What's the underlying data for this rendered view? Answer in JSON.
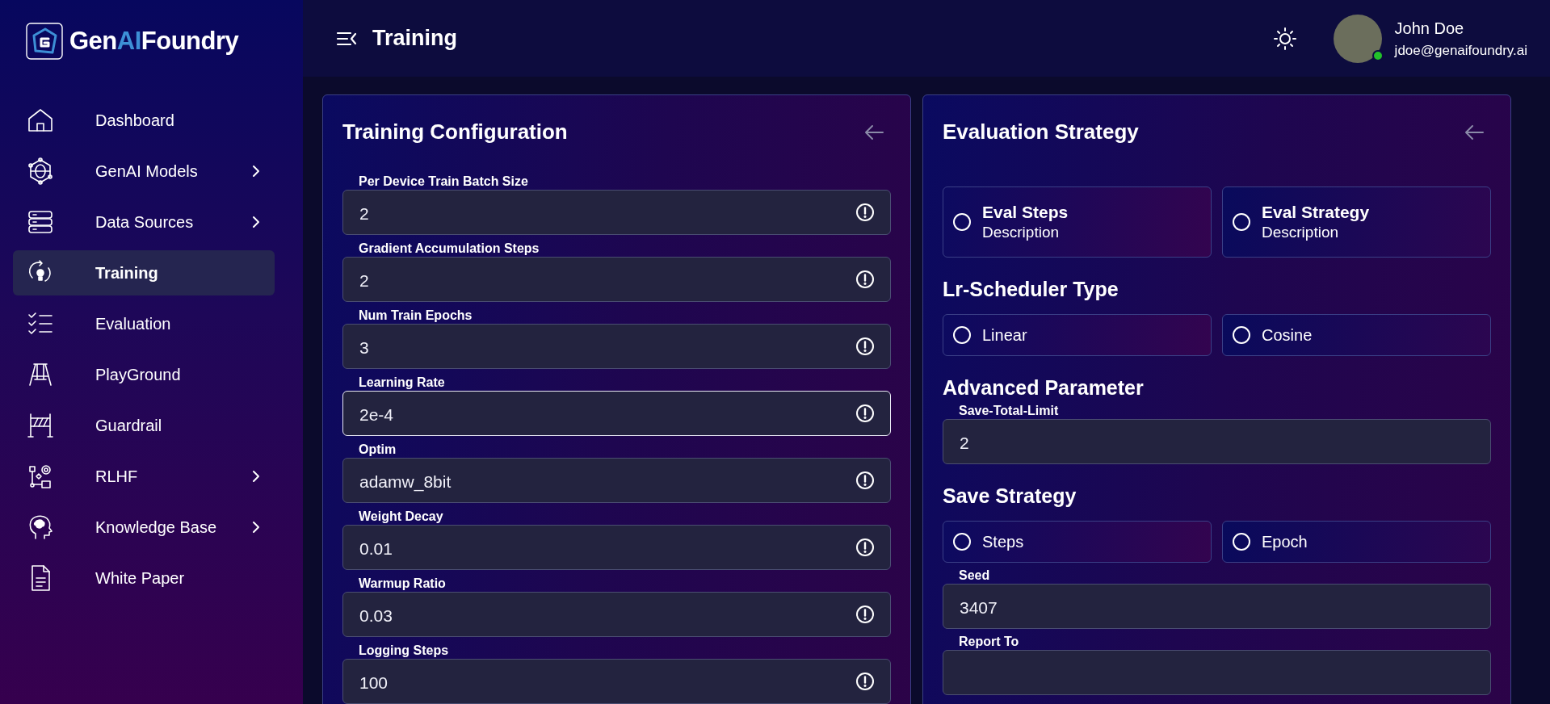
{
  "brand": {
    "prefix": "Gen",
    "accent": "AI",
    "suffix": "Foundry"
  },
  "sidebar": {
    "items": [
      {
        "label": "Dashboard",
        "expandable": false,
        "selected": false
      },
      {
        "label": "GenAI Models",
        "expandable": true,
        "selected": false
      },
      {
        "label": "Data Sources",
        "expandable": true,
        "selected": false
      },
      {
        "label": "Training",
        "expandable": false,
        "selected": true
      },
      {
        "label": "Evaluation",
        "expandable": false,
        "selected": false
      },
      {
        "label": "PlayGround",
        "expandable": false,
        "selected": false
      },
      {
        "label": "Guardrail",
        "expandable": false,
        "selected": false
      },
      {
        "label": "RLHF",
        "expandable": true,
        "selected": false
      },
      {
        "label": "Knowledge Base",
        "expandable": true,
        "selected": false
      },
      {
        "label": "White Paper",
        "expandable": false,
        "selected": false
      }
    ]
  },
  "header": {
    "title": "Training",
    "user": {
      "name": "John Doe",
      "email": "jdoe@genaifoundry.ai",
      "online": true
    }
  },
  "training_configuration": {
    "title": "Training Configuration",
    "fields": [
      {
        "label": "Per Device Train Batch Size",
        "value": "2",
        "focused": false
      },
      {
        "label": "Gradient Accumulation Steps",
        "value": "2",
        "focused": false
      },
      {
        "label": "Num Train Epochs",
        "value": "3",
        "focused": false
      },
      {
        "label": "Learning Rate",
        "value": "2e-4",
        "focused": true
      },
      {
        "label": "Optim",
        "value": "adamw_8bit",
        "focused": false
      },
      {
        "label": "Weight Decay",
        "value": "0.01",
        "focused": false
      },
      {
        "label": "Warmup Ratio",
        "value": "0.03",
        "focused": false
      },
      {
        "label": "Logging Steps",
        "value": "100",
        "focused": false
      }
    ]
  },
  "evaluation_strategy": {
    "title": "Evaluation Strategy",
    "blocks": [
      {
        "kind": "options",
        "options": [
          {
            "label": "Eval Steps",
            "description": "Description",
            "selected": false
          },
          {
            "label": "Eval Strategy",
            "description": "Description",
            "selected": false
          }
        ]
      },
      {
        "kind": "heading",
        "text": "Lr-Scheduler Type"
      },
      {
        "kind": "options",
        "options": [
          {
            "label": "Linear",
            "selected": false
          },
          {
            "label": "Cosine",
            "selected": false
          }
        ]
      },
      {
        "kind": "heading",
        "text": "Advanced Parameter"
      },
      {
        "kind": "field",
        "label": "Save-Total-Limit",
        "value": "2"
      },
      {
        "kind": "heading",
        "text": "Save Strategy"
      },
      {
        "kind": "options",
        "options": [
          {
            "label": "Steps",
            "selected": false
          },
          {
            "label": "Epoch",
            "selected": false
          }
        ]
      },
      {
        "kind": "field",
        "label": "Seed",
        "value": "3407"
      },
      {
        "kind": "field",
        "label": "Report To"
      }
    ]
  }
}
